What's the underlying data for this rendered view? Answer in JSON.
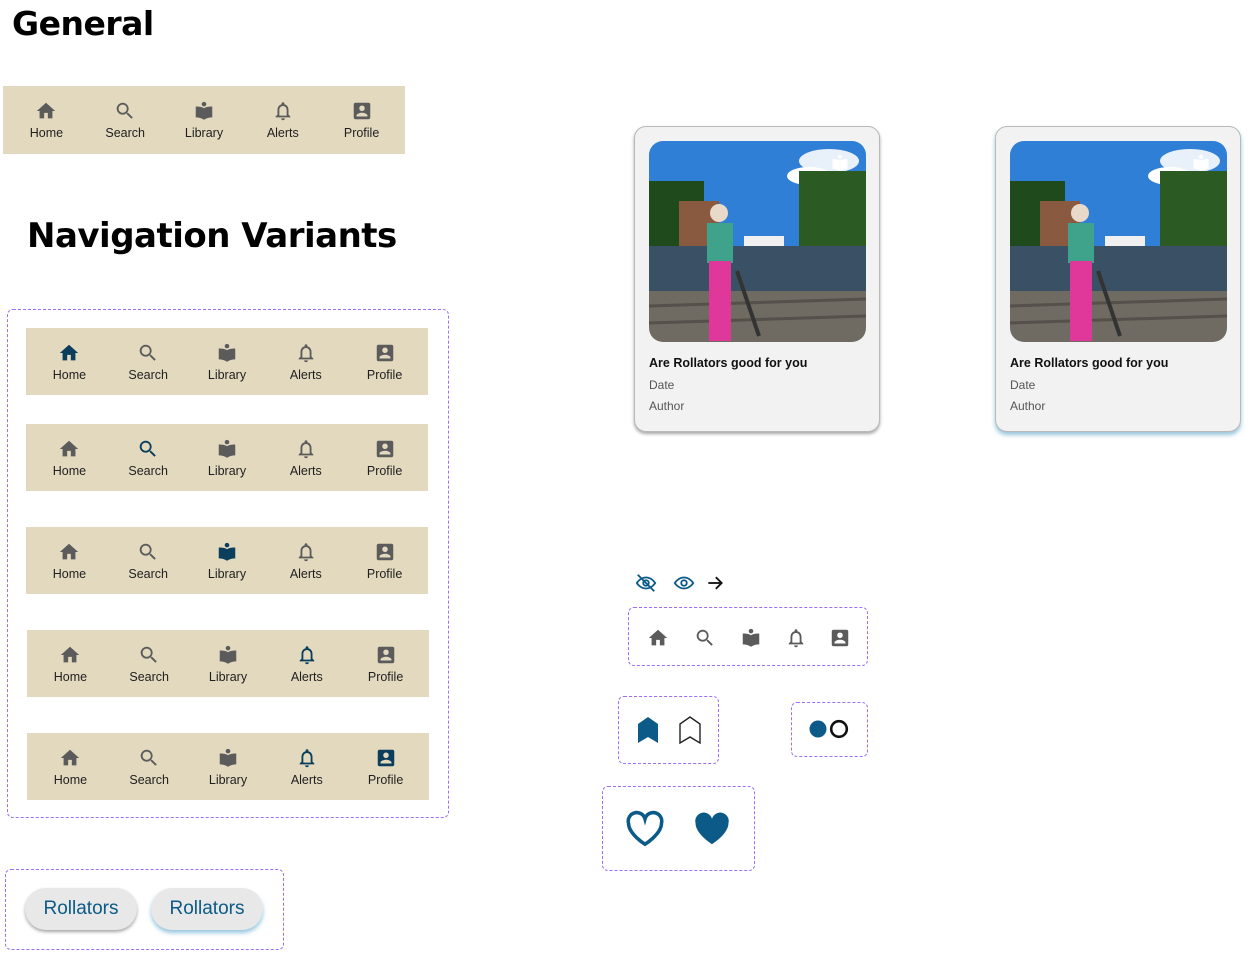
{
  "headings": {
    "general": "General",
    "navigation_variants": "Navigation Variants"
  },
  "nav_labels": {
    "home": "Home",
    "search": "Search",
    "library": "Library",
    "alerts": "Alerts",
    "profile": "Profile"
  },
  "nav_variants_active": [
    "home",
    "search",
    "library",
    "alerts",
    "profile"
  ],
  "article_cards": [
    {
      "title": "Are Rollators good for you",
      "date": "Date",
      "author": "Author"
    },
    {
      "title": "Are Rollators good for you",
      "date": "Date",
      "author": "Author"
    }
  ],
  "chips": [
    "Rollators",
    "Rollators"
  ],
  "colors": {
    "nav_background": "#e3d9bf",
    "icon_default": "#5b5b5b",
    "icon_active": "#0b3e5c",
    "accent": "#0b5a87",
    "dashed_border": "#9b6ef5"
  },
  "icons": [
    "home-icon",
    "search-icon",
    "library-icon",
    "bell-icon",
    "profile-icon",
    "eye-off-icon",
    "eye-icon",
    "arrow-right-icon",
    "bookmark-filled-icon",
    "bookmark-outline-icon",
    "radio-filled-icon",
    "radio-outline-icon",
    "heart-outline-icon",
    "heart-filled-icon"
  ]
}
